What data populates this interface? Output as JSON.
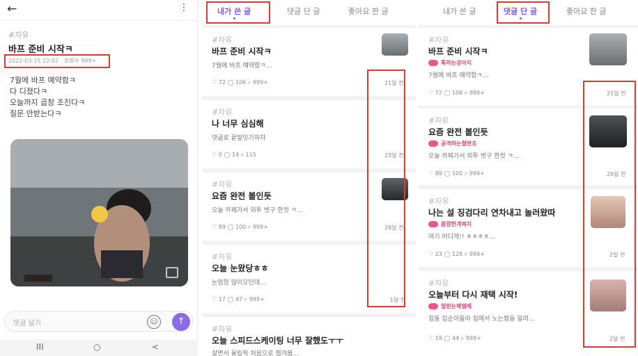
{
  "detail": {
    "tag": "#자유",
    "title": "바프 준비 시작ㅋ",
    "meta": "2022-03-15 22:02 · 조회수 999+",
    "body_lines": [
      "7월에 바프 예약함ㅋ",
      "다 디졌다ㅋ",
      "오늘까지 곱창 조진다ㅋ",
      "질문 안받는다ㅋ"
    ],
    "comment_placeholder": "댓글 달기",
    "icons": {
      "back": "back-arrow-icon",
      "more": "more-vertical-icon",
      "emoji": "emoji-icon",
      "send": "send-icon",
      "expand": "expand-icon"
    },
    "nav": [
      "III",
      "○",
      "<"
    ]
  },
  "tabs": [
    "내가 쓴 글",
    "댓글 단 글",
    "좋아요 한 글"
  ],
  "my_posts": [
    {
      "tag": "#자유",
      "title": "바프 준비 시작ㅋ",
      "body": "7월에 바프 예약함ㅋ…",
      "likes": "72",
      "comments": "106",
      "views": "999+",
      "date": "21일 전",
      "has_thumb": true
    },
    {
      "tag": "#자유",
      "title": "나 너무 심심해",
      "body": "댓글로 끝말잇기하자",
      "likes": "0",
      "comments": "14",
      "views": "115",
      "date": "25일 전",
      "has_thumb": false
    },
    {
      "tag": "#자유",
      "title": "요즘 완전 볼인듯",
      "body": "오늘 카페가서 외투 벗구 한컷 ㅋ…",
      "likes": "89",
      "comments": "100",
      "views": "999+",
      "date": "26일 전",
      "has_thumb": true
    },
    {
      "tag": "#자유",
      "title": "오늘 눈왔당ㅎㅎ",
      "body": "눈엄청 많이오던데…",
      "likes": "17",
      "comments": "47",
      "views": "999+",
      "date": "1달 전",
      "has_thumb": false
    },
    {
      "tag": "#자유",
      "title": "오늘 스피드스케이팅 너무 잘했도ㅜㅜ",
      "body": "살면서 올림픽 처음으로 챙겨봄…",
      "likes": "",
      "comments": "",
      "views": "",
      "date": "",
      "has_thumb": false
    }
  ],
  "commented_posts": [
    {
      "tag": "#자유",
      "title": "바프 준비 시작ㅋ",
      "badge": "톡하는강아지",
      "body": "7월에 바프 예약함ㅋ…",
      "likes": "72",
      "comments": "106",
      "views": "999+",
      "date": "21일 전"
    },
    {
      "tag": "#자유",
      "title": "요즘 완전 볼인듯",
      "badge": "공격하는철면조",
      "body": "오늘 카페가서 외투 벗구 한컷 ㅋ…",
      "likes": "89",
      "comments": "100",
      "views": "999+",
      "date": "26일 전"
    },
    {
      "tag": "#자유",
      "title": "나는 설 징검다리 연차내고 놀러왔따",
      "badge": "몸깜한개복지",
      "body": "여기 어디게!! ㅎㅎㅎㅎ…",
      "likes": "23",
      "comments": "128",
      "views": "999+",
      "date": "2일 전"
    },
    {
      "tag": "#자유",
      "title": "오늘부터 다시 재택 시작!",
      "badge": "얼받는해벌레",
      "body": "집돌 집순이들아 집에서 노는법을 알려…",
      "likes": "19",
      "comments": "44",
      "views": "999+",
      "date": "2달 전"
    }
  ],
  "colors": {
    "accent": "#7c5ae0",
    "highlight": "#d83a34",
    "badge": "#e0457a"
  }
}
